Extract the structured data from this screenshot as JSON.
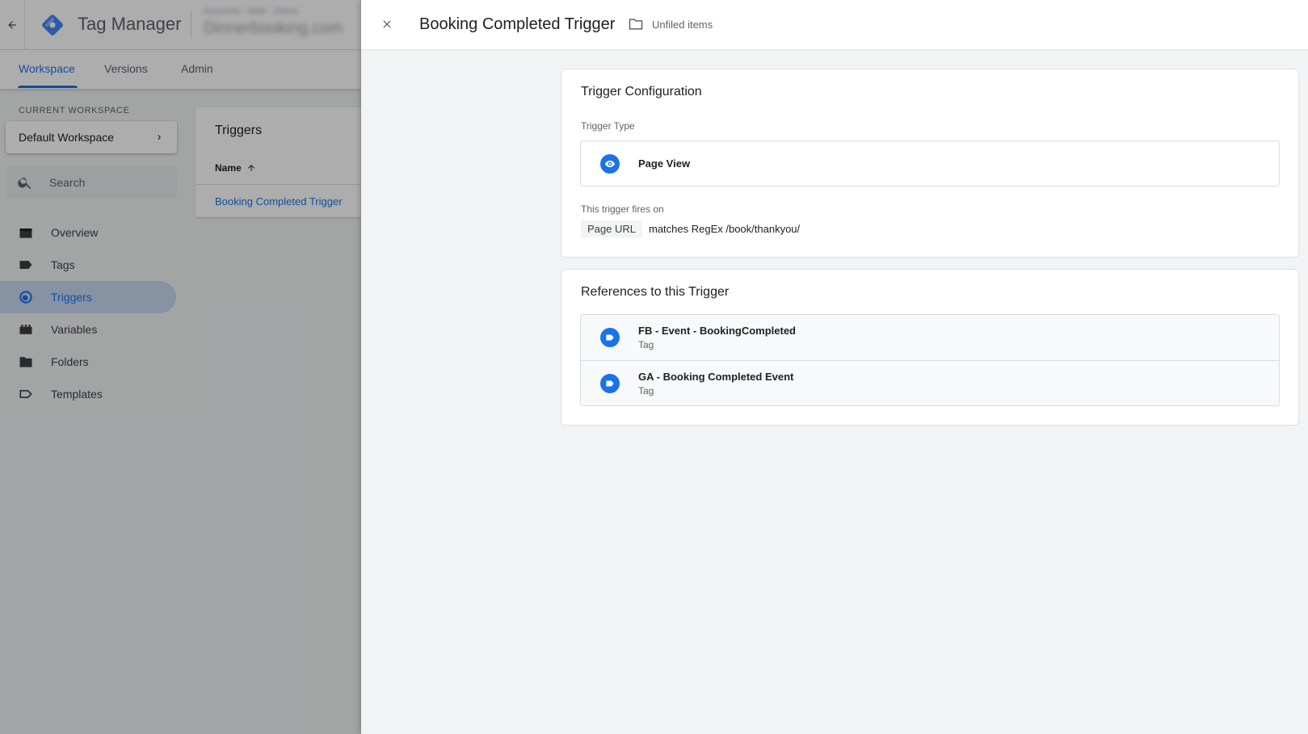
{
  "app": {
    "title": "Tag Manager",
    "account_line1": "Accounts › Web · Demo",
    "account_line2": "Dinnerbooking.com"
  },
  "nav": {
    "tabs": [
      {
        "label": "Workspace",
        "active": true
      },
      {
        "label": "Versions",
        "active": false
      },
      {
        "label": "Admin",
        "active": false
      }
    ]
  },
  "sidebar": {
    "workspace_caption": "CURRENT WORKSPACE",
    "workspace_name": "Default Workspace",
    "search_placeholder": "Search",
    "items": [
      {
        "label": "Overview",
        "icon": "briefcase-icon",
        "active": false
      },
      {
        "label": "Tags",
        "icon": "tag-icon",
        "active": false
      },
      {
        "label": "Triggers",
        "icon": "trigger-icon",
        "active": true
      },
      {
        "label": "Variables",
        "icon": "variables-icon",
        "active": false
      },
      {
        "label": "Folders",
        "icon": "folder-icon",
        "active": false
      },
      {
        "label": "Templates",
        "icon": "template-icon",
        "active": false
      }
    ]
  },
  "triggers_list": {
    "title": "Triggers",
    "column_name": "Name",
    "rows": [
      "Booking Completed Trigger"
    ]
  },
  "panel": {
    "title": "Booking Completed Trigger",
    "folder": "Unfiled items",
    "config": {
      "title": "Trigger Configuration",
      "type_caption": "Trigger Type",
      "type_name": "Page View",
      "fires_caption": "This trigger fires on",
      "condition_variable": "Page URL",
      "condition_rest": "matches RegEx /book/thankyou/"
    },
    "references": {
      "title": "References to this Trigger",
      "items": [
        {
          "name": "FB - Event - BookingCompleted",
          "type": "Tag"
        },
        {
          "name": "GA - Booking Completed Event",
          "type": "Tag"
        }
      ]
    }
  },
  "colors": {
    "accent": "#1a73e8",
    "active_bg": "#c8d7ef",
    "panel_bg": "#f1f3f4"
  }
}
